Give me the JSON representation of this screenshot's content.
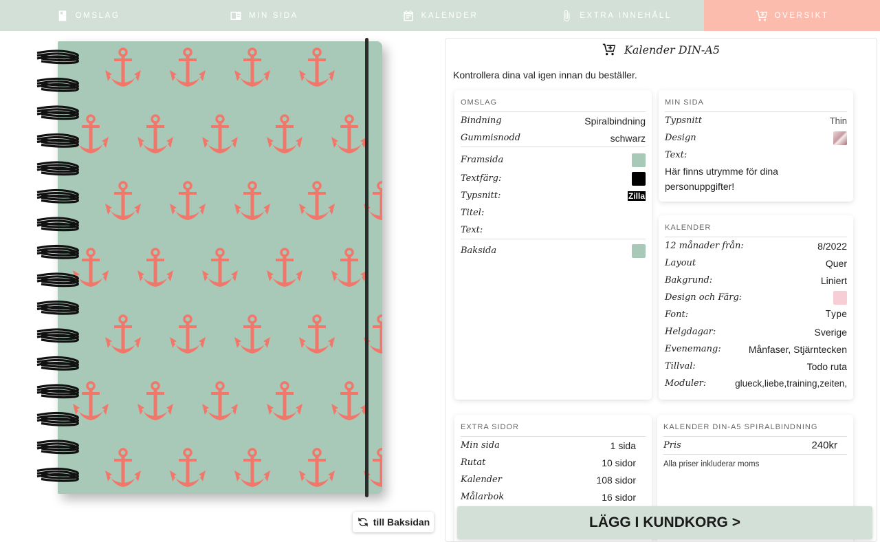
{
  "nav": {
    "tabs": [
      {
        "label": "OMSLAG",
        "icon": "notebook-icon"
      },
      {
        "label": "MIN SIDA",
        "icon": "page-icon"
      },
      {
        "label": "KALENDER",
        "icon": "calendar-icon"
      },
      {
        "label": "EXTRA INNEHÅLL",
        "icon": "paperclip-icon"
      },
      {
        "label": "OVERSIKT",
        "icon": "cart-icon",
        "active": true
      }
    ],
    "colors": {
      "bar": "#d3e0d7",
      "active": "#fbbcad"
    }
  },
  "notebook": {
    "cover_color": "#a9c9b8",
    "anchor_color": "#f0776a",
    "swap_button": "till Baksidan"
  },
  "summary": {
    "title": "Kalender DIN-A5",
    "intro": "Kontrollera dina val igen innan du beställer.",
    "omslag": {
      "heading": "OMSLAG",
      "bindning_label": "Bindning",
      "bindning_value": "Spiralbindning",
      "gummisnodd_label": "Gummisnodd",
      "gummisnodd_value": "schwarz",
      "framsida_label": "Framsida",
      "framsida_color": "#a9c9b8",
      "textfarg_label": "Textfärg:",
      "textfarg_color": "#000000",
      "typsnitt_label": "Typsnitt:",
      "typsnitt_value": "Zilla",
      "titel_label": "Titel:",
      "text_label": "Text:",
      "baksida_label": "Baksida",
      "baksida_color": "#a9c9b8"
    },
    "min_sida": {
      "heading": "MIN SIDA",
      "typsnitt_label": "Typsnitt",
      "typsnitt_value": "Thin",
      "design_label": "Design",
      "text_label": "Text:",
      "text_value": "Här finns utrymme för dina personuppgifter!"
    },
    "kalender": {
      "heading": "KALENDER",
      "rows": [
        {
          "label": "12 månader från:",
          "value": "8/2022"
        },
        {
          "label": "Layout",
          "value": "Quer"
        },
        {
          "label": "Bakgrund:",
          "value": "Liniert"
        },
        {
          "label": "Design och Färg:",
          "value": ""
        },
        {
          "label": "Font:",
          "value": "Type"
        },
        {
          "label": "Helgdagar:",
          "value": "Sverige"
        },
        {
          "label": "Evenemang:",
          "value": "Månfaser, Stjärntecken"
        },
        {
          "label": "Tillval:",
          "value": "Todo ruta"
        },
        {
          "label": "Moduler:",
          "value": "glueck,liebe,training,zeiten,"
        }
      ],
      "design_color": "#f7cdd6"
    },
    "extra_sidor": {
      "heading": "EXTRA SIDOR",
      "rows": [
        {
          "label": "Min sida",
          "value": "1 sida"
        },
        {
          "label": "Rutat",
          "value": "10 sidor"
        },
        {
          "label": "Kalender",
          "value": "108 sidor"
        },
        {
          "label": "Målarbok",
          "value": "16 sidor"
        }
      ]
    },
    "price": {
      "heading": "KALENDER DIN-A5 SPIRALBINDNING",
      "label": "Pris",
      "value": "240kr",
      "note": "Alla priser inkluderar moms"
    },
    "cart_button": "LÄGG I KUNDKORG >"
  }
}
